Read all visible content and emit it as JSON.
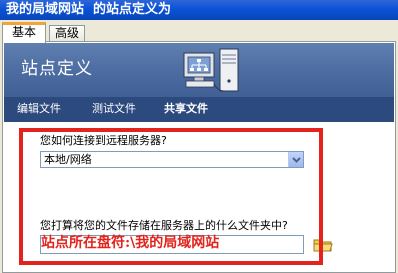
{
  "window": {
    "title": "我的局域网站  的站点定义为"
  },
  "tabs": [
    {
      "label": "基本",
      "active": true
    },
    {
      "label": "高级",
      "active": false
    }
  ],
  "banner": {
    "title": "站点定义",
    "icon": "server-network-icon"
  },
  "nav": [
    {
      "label": "编辑文件",
      "current": false
    },
    {
      "label": "测试文件",
      "current": false
    },
    {
      "label": "共享文件",
      "current": true
    }
  ],
  "form": {
    "connect_question": "您如何连接到远程服务器?",
    "connect_selected": "本地/网络",
    "folder_question": "您打算将您的文件存储在服务器上的什么文件夹中?",
    "folder_value": "",
    "browse_icon": "folder-icon"
  },
  "annotation": {
    "text": "站点所在盘符:\\我的局域网站",
    "color": "#e2241c"
  },
  "colors": {
    "titlebar": "#0a52d6",
    "banner": "#4a6aa0",
    "nav_bar": "#2c4a7e",
    "highlight": "#e2241c"
  }
}
